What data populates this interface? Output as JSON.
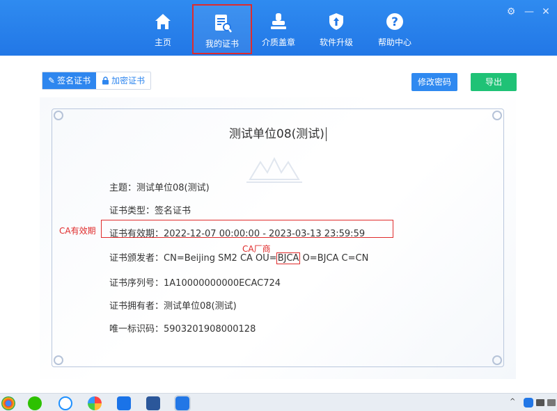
{
  "nav": [
    {
      "label": "主页",
      "icon": "home-icon"
    },
    {
      "label": "我的证书",
      "icon": "certificate-icon"
    },
    {
      "label": "介质盖章",
      "icon": "stamp-icon"
    },
    {
      "label": "软件升级",
      "icon": "upgrade-shield-icon"
    },
    {
      "label": "帮助中心",
      "icon": "help-icon"
    }
  ],
  "tabs": [
    {
      "label": "签名证书",
      "icon": "pen-icon"
    },
    {
      "label": "加密证书",
      "icon": "lock-icon"
    }
  ],
  "buttons": {
    "modify_password": "修改密码",
    "export": "导出"
  },
  "certificate": {
    "title": "测试单位08(测试)",
    "fields": [
      {
        "key": "主题：",
        "value": "测试单位08(测试)"
      },
      {
        "key": "证书类型：",
        "value": "签名证书"
      },
      {
        "key": "证书有效期：",
        "value": "2022-12-07 00:00:00 - 2023-03-13 23:59:59"
      },
      {
        "key": "证书颁发者：",
        "value_prefix": "CN=Beijing SM2 CA OU=",
        "value_highlight": "BJCA",
        "value_suffix": " O=BJCA C=CN"
      },
      {
        "key": "证书序列号：",
        "value": "1A10000000000ECAC724"
      },
      {
        "key": "证书拥有者：",
        "value": "测试单位08(测试)"
      },
      {
        "key": "唯一标识码：",
        "value": "5903201908000128"
      }
    ]
  },
  "annotations": {
    "validity": "CA有效期",
    "vendor": "CA厂商"
  },
  "colors": {
    "header": "#2277e6",
    "primary": "#2e86ef",
    "success": "#1fc276",
    "annotation": "#e02b2b"
  }
}
